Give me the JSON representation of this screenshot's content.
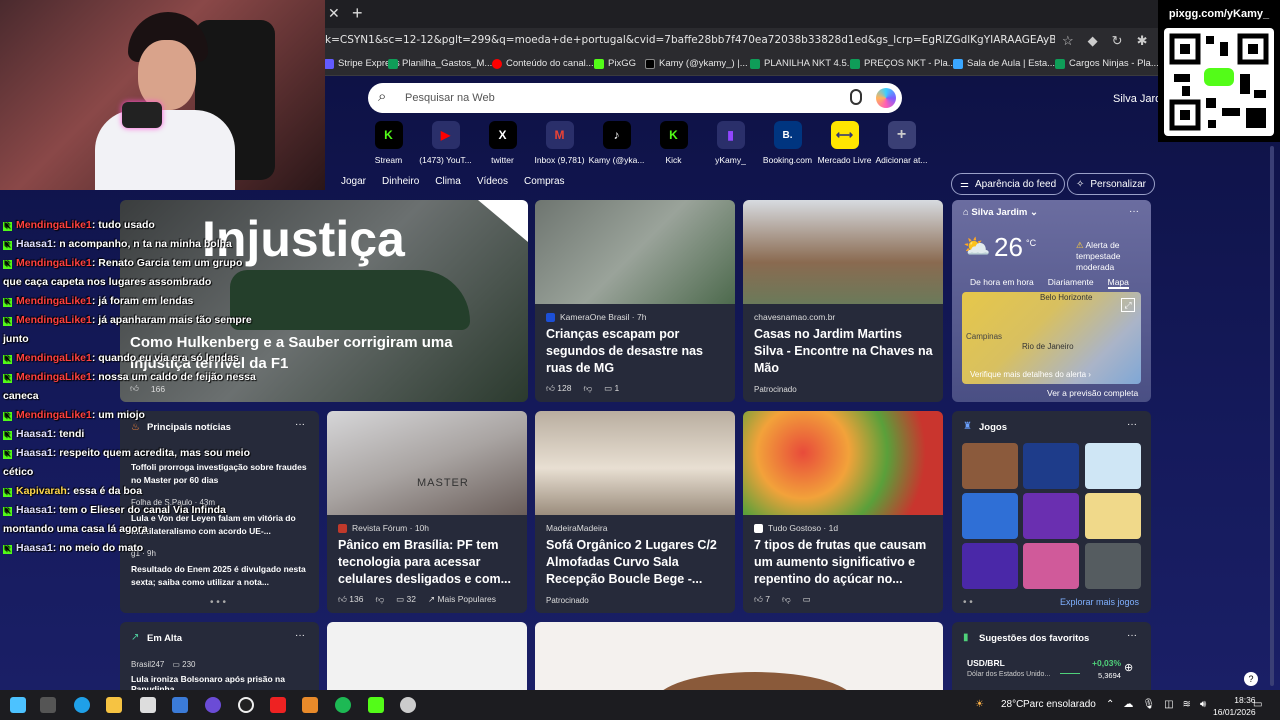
{
  "browser": {
    "url": "k=CSYN1&sc=12-12&pglt=299&q=moeda+de+portugal&cvid=7baffe28bb7f470ea72038b33828d1ed&gs_lcrp=EgRlZGdlKgYIARAAGEAyBggAEEUYOTIGCAEQABhAMgYIAhAA...",
    "favorites": [
      {
        "label": "Stripe Express",
        "color": "#635bff"
      },
      {
        "label": "Planilha_Gastos_M...",
        "color": "#0f9d58"
      },
      {
        "label": "Conteúdo do canal...",
        "color": "#ff0000"
      },
      {
        "label": "PixGG",
        "color": "#53fc18"
      },
      {
        "label": "Kamy (@ykamy_) |...",
        "color": "#000000"
      },
      {
        "label": "PLANILHA NKT 4.5...",
        "color": "#0f9d58"
      },
      {
        "label": "PREÇOS NKT - Pla...",
        "color": "#0f9d58"
      },
      {
        "label": "Sala de Aula | Esta...",
        "color": "#3aa7ff"
      },
      {
        "label": "Cargos Ninjas - Pla...",
        "color": "#0f9d58"
      }
    ]
  },
  "newtab": {
    "search_placeholder": "Pesquisar na Web",
    "user_name": "Silva Jard",
    "shortcuts": [
      {
        "label": "Stream",
        "glyph": "K",
        "color": "#53fc18"
      },
      {
        "label": "(1473) YouT...",
        "glyph": "▶",
        "color": "#ff0000"
      },
      {
        "label": "twitter",
        "glyph": "X",
        "color": "#000000"
      },
      {
        "label": "Inbox (9,781)",
        "glyph": "M",
        "color": "#ea4335"
      },
      {
        "label": "Kamy (@yka...",
        "glyph": "♪",
        "color": "#000000"
      },
      {
        "label": "Kick",
        "glyph": "K",
        "color": "#53fc18"
      },
      {
        "label": "yKamy_",
        "glyph": "▮",
        "color": "#9146ff"
      },
      {
        "label": "Booking.com",
        "glyph": "B.",
        "color": "#003580"
      },
      {
        "label": "Mercado Livre",
        "glyph": "⟷",
        "color": "#ffe600"
      },
      {
        "label": "Adicionar at...",
        "glyph": "+",
        "color": "#3a3f75"
      }
    ],
    "nav": [
      "s",
      "Jogar",
      "Dinheiro",
      "Clima",
      "Vídeos",
      "Compras"
    ],
    "appearance_btn": "Aparência do feed",
    "personalize_btn": "Personalizar"
  },
  "hero": {
    "overlay_text": "Injustiça",
    "title": "Como Hulkenberg e a Sauber corrigiram uma injustiça terrível da F1",
    "likes": "166"
  },
  "cards": {
    "c1": {
      "source": "KameraOne Brasil · 7h",
      "title": "Crianças escapam por segundos de desastre nas ruas de MG",
      "likes": "128",
      "comments": "1"
    },
    "c2": {
      "source": "chavesnamao.com.br",
      "title": "Casas no Jardim Martins Silva - Encontre na Chaves na Mão",
      "sponsored": "Patrocinado"
    },
    "c3": {
      "source": "Revista Fórum · 10h",
      "title": "Pânico em Brasília: PF tem tecnologia para acessar celulares desligados e com...",
      "likes": "136",
      "comments": "32",
      "popular": "Mais Populares",
      "img_text": "MASTER"
    },
    "c4": {
      "source": "MadeiraMadeira",
      "title": "Sofá Orgânico 2 Lugares C/2 Almofadas Curvo Sala Recepção Boucle Bege -...",
      "sponsored": "Patrocinado"
    },
    "c5": {
      "source": "Tudo Gostoso · 1d",
      "title": "7 tipos de frutas que causam um aumento significativo e repentino do açúcar no...",
      "likes": "7"
    }
  },
  "top_news": {
    "title": "Principais notícias",
    "items": [
      {
        "source": "",
        "headline": "Toffoli prorroga investigação sobre fraudes no Master por 60 dias"
      },
      {
        "source": "Folha de S.Paulo · 43m",
        "headline": "Lula e Von der Leyen falam em vitória do multilateralismo com acordo UE-..."
      },
      {
        "source": "g1 · 9h",
        "headline": "Resultado do Enem 2025 é divulgado nesta sexta; saiba como utilizar a nota..."
      }
    ]
  },
  "trending": {
    "title": "Em Alta",
    "source": "Brasil247",
    "count": "230",
    "headline": "Lula ironiza Bolsonaro após prisão na Papudinha..."
  },
  "weather": {
    "location": "Silva Jardim",
    "temp": "26",
    "unit": "°C",
    "alert": "Alerta de tempestade moderada",
    "tabs": [
      "De hora em hora",
      "Diariamente",
      "Mapa"
    ],
    "map_labels": [
      "Belo Horizonte",
      "Campinas",
      "Rio de Janeiro"
    ],
    "map_link": "Verifique mais detalhes do alerta ›",
    "full_forecast": "Ver a previsão completa"
  },
  "games": {
    "title": "Jogos",
    "explore": "Explorar mais jogos"
  },
  "favorites_widget": {
    "title": "Sugestões dos favoritos",
    "pair": "USD/BRL",
    "pair_desc": "Dólar dos Estados Unido...",
    "change": "+0,03%",
    "value": "5,3694"
  },
  "overlay": {
    "qr_text": "pixgg.com/yKamy_",
    "chat": [
      {
        "user": "MendingaLike1",
        "text": ": tudo usado",
        "color": "#ff4040"
      },
      {
        "user": "Haasa1",
        "text": ": n acompanho, n ta na minha bolha",
        "color": "#e0e0ff"
      },
      {
        "user": "MendingaLike1",
        "text": ": Renato Garcia tem um grupo",
        "color": "#ff4040"
      },
      {
        "user": "",
        "text": "que caça capeta nos lugares assombrado",
        "color": ""
      },
      {
        "user": "MendingaLike1",
        "text": ": já foram em lendas",
        "color": "#ff4040"
      },
      {
        "user": "MendingaLike1",
        "text": ": já apanharam mais tão sempre",
        "color": "#ff4040"
      },
      {
        "user": "",
        "text": "junto",
        "color": ""
      },
      {
        "user": "MendingaLike1",
        "text": ": quando eu via era só lendas",
        "color": "#ff4040"
      },
      {
        "user": "MendingaLike1",
        "text": ": nossa um caldo de feijão nessa",
        "color": "#ff4040"
      },
      {
        "user": "",
        "text": "caneca",
        "color": ""
      },
      {
        "user": "MendingaLike1",
        "text": ": um miojo",
        "color": "#ff4040"
      },
      {
        "user": "Haasa1",
        "text": ": tendi",
        "color": "#e0e0ff"
      },
      {
        "user": "Haasa1",
        "text": ": respeito quem acredita, mas sou meio",
        "color": "#e0e0ff"
      },
      {
        "user": "",
        "text": "cético",
        "color": ""
      },
      {
        "user": "Kapivarah",
        "text": ": essa é da boa",
        "color": "#ffd84d"
      },
      {
        "user": "Haasa1",
        "text": ": tem o Elieser do canal Via Infinda",
        "color": "#e0e0ff"
      },
      {
        "user": "",
        "text": "montando uma casa lá agora",
        "color": ""
      },
      {
        "user": "Haasa1",
        "text": ": no meio do mato",
        "color": "#e0e0ff"
      }
    ]
  },
  "taskbar": {
    "weather": "28°C",
    "weather_desc": "Parc ensolarado",
    "time": "18:36",
    "date": "16/01/2026"
  }
}
